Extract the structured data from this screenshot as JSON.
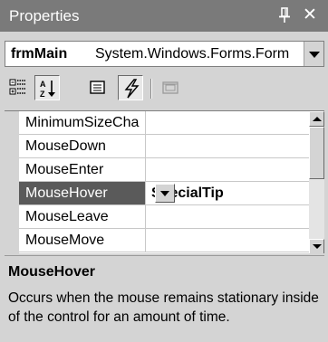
{
  "window": {
    "title": "Properties",
    "pin_icon": "pushpin-icon",
    "close_icon": "close-icon",
    "close_glyph": "✕"
  },
  "object_selector": {
    "name": "frmMain",
    "type": "System.Windows.Forms.Form"
  },
  "toolbar": {
    "buttons": [
      {
        "icon": "categorized-icon",
        "pressed": false
      },
      {
        "icon": "alphabetical-icon",
        "pressed": true
      },
      {
        "icon": "properties-icon",
        "pressed": false
      },
      {
        "icon": "events-lightning-icon",
        "pressed": true
      },
      {
        "icon": "property-pages-icon",
        "pressed": false,
        "disabled": true
      }
    ]
  },
  "grid": {
    "rows": [
      {
        "name": "MinimumSizeCha",
        "value": ""
      },
      {
        "name": "MouseDown",
        "value": ""
      },
      {
        "name": "MouseEnter",
        "value": ""
      },
      {
        "name": "MouseHover",
        "value": "SpecialTip",
        "selected": true
      },
      {
        "name": "MouseLeave",
        "value": ""
      },
      {
        "name": "MouseMove",
        "value": ""
      }
    ]
  },
  "description": {
    "title": "MouseHover",
    "text": "Occurs when the mouse remains stationary inside of the control for an amount of time."
  },
  "colors": {
    "titlebar": "#7a7a7a",
    "selected_row": "#5a5a5a",
    "panel": "#d4d4d4"
  }
}
